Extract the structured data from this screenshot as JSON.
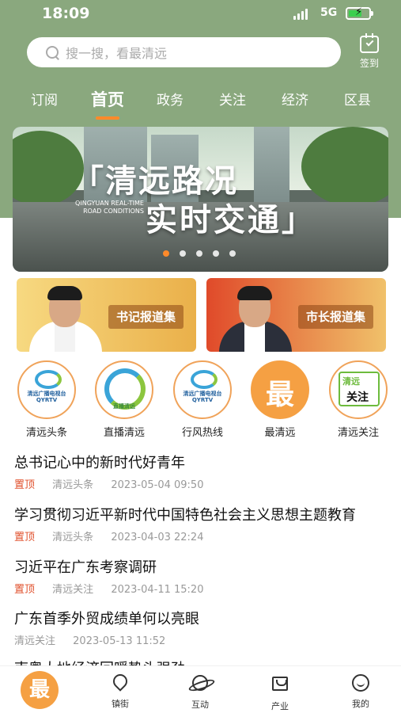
{
  "status_bar": {
    "time": "18:09",
    "network": "5G"
  },
  "header": {
    "search_placeholder": "搜一搜，看最清远",
    "checkin_label": "签到",
    "colors": {
      "header_bg": "#8aa87e",
      "accent": "#ff8a2a"
    }
  },
  "tabs": [
    "订阅",
    "首页",
    "政务",
    "关注",
    "经济",
    "区县"
  ],
  "active_tab": "首页",
  "banner": {
    "line1": "「清远路况",
    "line2": "实时交通」",
    "subtitle": "QINGYUAN REAL-TIME ROAD CONDITIONS",
    "slide_count": 5,
    "active_slide": 1
  },
  "reports": [
    {
      "label": "书记报道集"
    },
    {
      "label": "市长报道集"
    }
  ],
  "channels": [
    {
      "label": "清远头条",
      "logo_text": "清远广播电视台 QYRTV",
      "icon": "qyrtv-logo-icon"
    },
    {
      "label": "直播清远",
      "logo_text": "直播清远",
      "icon": "live-qingyuan-logo-icon"
    },
    {
      "label": "行风热线",
      "logo_text": "清远广播电视台 QYRTV",
      "icon": "qyrtv-logo-icon"
    },
    {
      "label": "最清远",
      "logo_text": "最",
      "icon": "zui-logo-icon"
    },
    {
      "label": "清远关注",
      "logo_text": "清远 关注",
      "icon": "qingyuan-focus-logo-icon"
    }
  ],
  "news": [
    {
      "title": "总书记心中的新时代好青年",
      "pinned": "置顶",
      "source": "清远头条",
      "time": "2023-05-04 09:50"
    },
    {
      "title": "学习贯彻习近平新时代中国特色社会主义思想主题教育",
      "pinned": "置顶",
      "source": "清远头条",
      "time": "2023-04-03 22:24"
    },
    {
      "title": "习近平在广东考察调研",
      "pinned": "置顶",
      "source": "清远关注",
      "time": "2023-04-11 15:20"
    },
    {
      "title": "广东首季外贸成绩单何以亮眼",
      "pinned": "",
      "source": "清远关注",
      "time": "2023-05-13 11:52"
    },
    {
      "title": "南粤大地经济回暖势头强劲",
      "pinned": "",
      "source": "",
      "time": ""
    }
  ],
  "tabbar": [
    {
      "label": "",
      "glyph": "最",
      "icon": "home-zui-icon"
    },
    {
      "label": "镇街",
      "icon": "location-pin-icon"
    },
    {
      "label": "互动",
      "icon": "planet-icon"
    },
    {
      "label": "产业",
      "icon": "shopping-bag-icon"
    },
    {
      "label": "我的",
      "icon": "smiley-face-icon"
    }
  ]
}
